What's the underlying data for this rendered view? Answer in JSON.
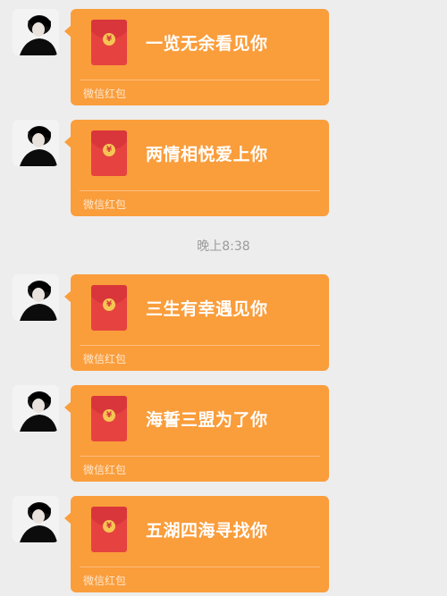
{
  "time_label": "晚上8:38",
  "messages": [
    {
      "title": "一览无余看见你",
      "footer": "微信红包",
      "coin": "¥"
    },
    {
      "title": "两情相悦爱上你",
      "footer": "微信红包",
      "coin": "¥"
    },
    {
      "title": "三生有幸遇见你",
      "footer": "微信红包",
      "coin": "¥"
    },
    {
      "title": "海誓三盟为了你",
      "footer": "微信红包",
      "coin": "¥"
    },
    {
      "title": "五湖四海寻找你",
      "footer": "微信红包",
      "coin": "¥"
    }
  ],
  "colors": {
    "bubble": "#fa9d3b",
    "envelope": "#e64340",
    "background": "#ededed"
  },
  "icons": {
    "avatar": "avatar-icon",
    "envelope": "red-packet-icon"
  }
}
